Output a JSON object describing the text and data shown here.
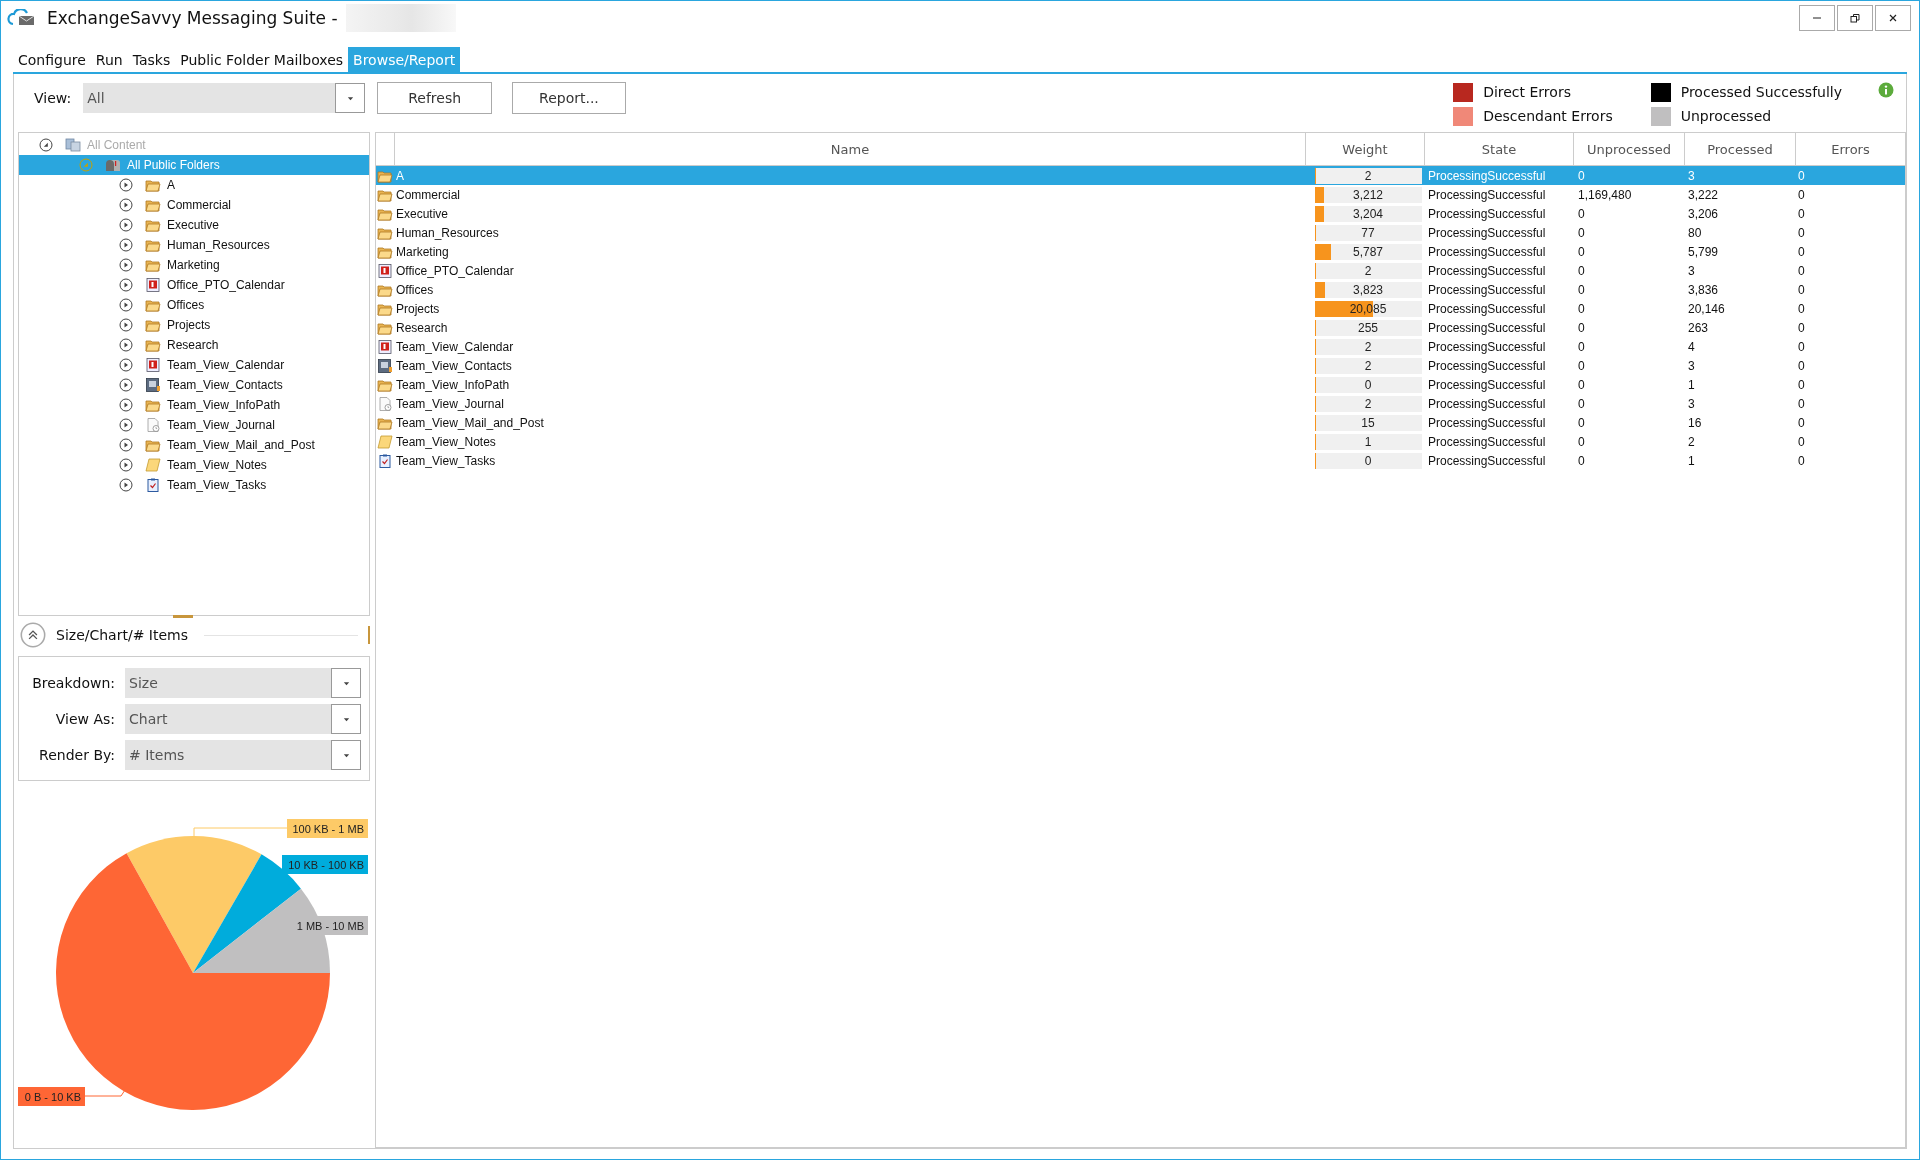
{
  "window": {
    "title": "ExchangeSavvy Messaging Suite -"
  },
  "tabs": [
    {
      "label": "Configure",
      "selected": false
    },
    {
      "label": "Run",
      "selected": false
    },
    {
      "label": "Tasks",
      "selected": false
    },
    {
      "label": "Public Folder Mailboxes",
      "selected": false
    },
    {
      "label": "Browse/Report",
      "selected": true
    }
  ],
  "toolbar": {
    "view_label": "View:",
    "view_value": "All",
    "buttons": [
      "Refresh",
      "Report..."
    ]
  },
  "legend": [
    {
      "label": "Direct Errors",
      "color": "#b8281f"
    },
    {
      "label": "Descendant Errors",
      "color": "#f08878"
    },
    {
      "label": "Processed Successfully",
      "color": "#000000"
    },
    {
      "label": "Unprocessed",
      "color": "#c0bfc0"
    }
  ],
  "tree": [
    {
      "label": "All Content",
      "kind": "content",
      "expanded": true,
      "disabled": true,
      "selected": false,
      "children": [
        {
          "label": "All Public Folders",
          "kind": "mailbox",
          "expanded": true,
          "disabled": false,
          "selected": true,
          "children": [
            {
              "label": "A",
              "kind": "folder",
              "expanded": false,
              "disabled": false,
              "selected": false
            },
            {
              "label": "Commercial",
              "kind": "folder",
              "expanded": false,
              "disabled": false,
              "selected": false
            },
            {
              "label": "Executive",
              "kind": "folder",
              "expanded": false,
              "disabled": false,
              "selected": false
            },
            {
              "label": "Human_Resources",
              "kind": "folder",
              "expanded": false,
              "disabled": false,
              "selected": false
            },
            {
              "label": "Marketing",
              "kind": "folder",
              "expanded": false,
              "disabled": false,
              "selected": false
            },
            {
              "label": "Office_PTO_Calendar",
              "kind": "calendar",
              "expanded": false,
              "disabled": false,
              "selected": false
            },
            {
              "label": "Offices",
              "kind": "folder",
              "expanded": false,
              "disabled": false,
              "selected": false
            },
            {
              "label": "Projects",
              "kind": "folder",
              "expanded": false,
              "disabled": false,
              "selected": false
            },
            {
              "label": "Research",
              "kind": "folder",
              "expanded": false,
              "disabled": false,
              "selected": false
            },
            {
              "label": "Team_View_Calendar",
              "kind": "calendar",
              "expanded": false,
              "disabled": false,
              "selected": false
            },
            {
              "label": "Team_View_Contacts",
              "kind": "contacts",
              "expanded": false,
              "disabled": false,
              "selected": false
            },
            {
              "label": "Team_View_InfoPath",
              "kind": "folder",
              "expanded": false,
              "disabled": false,
              "selected": false
            },
            {
              "label": "Team_View_Journal",
              "kind": "journal",
              "expanded": false,
              "disabled": false,
              "selected": false
            },
            {
              "label": "Team_View_Mail_and_Post",
              "kind": "folder",
              "expanded": false,
              "disabled": false,
              "selected": false
            },
            {
              "label": "Team_View_Notes",
              "kind": "notes",
              "expanded": false,
              "disabled": false,
              "selected": false
            },
            {
              "label": "Team_View_Tasks",
              "kind": "tasks",
              "expanded": false,
              "disabled": false,
              "selected": false
            }
          ]
        }
      ]
    }
  ],
  "breakdown": {
    "title": "Size/Chart/# Items",
    "expanded": true,
    "fields": [
      {
        "label": "Breakdown:",
        "value": "Size"
      },
      {
        "label": "View As:",
        "value": "Chart"
      },
      {
        "label": "Render By:",
        "value": "# Items"
      }
    ]
  },
  "size_chart": {
    "slices": [
      {
        "label": "100 KB - 1 MB",
        "color": "#fdca67"
      },
      {
        "label": "10 KB - 100 KB",
        "color": "#00acdc"
      },
      {
        "label": "1 MB - 10 MB",
        "color": "#c0bfc0"
      },
      {
        "label": "0 B - 10 KB",
        "color": "#fe6635"
      }
    ]
  },
  "table": {
    "columns": [
      "Name",
      "Weight",
      "State",
      "Unprocessed",
      "Processed",
      "Errors"
    ],
    "rows": [
      {
        "name": "A",
        "kind": "folder",
        "weight": "2",
        "level": 0,
        "state": "ProcessingSuccessful",
        "unprocessed": "0",
        "processed": "3",
        "errors": "0",
        "selected": true
      },
      {
        "name": "Commercial",
        "kind": "folder",
        "weight": "3,212",
        "level": 0.086,
        "state": "ProcessingSuccessful",
        "unprocessed": "1,169,480",
        "processed": "3,222",
        "errors": "0",
        "selected": false
      },
      {
        "name": "Executive",
        "kind": "folder",
        "weight": "3,204",
        "level": 0.086,
        "state": "ProcessingSuccessful",
        "unprocessed": "0",
        "processed": "3,206",
        "errors": "0",
        "selected": false
      },
      {
        "name": "Human_Resources",
        "kind": "folder",
        "weight": "77",
        "level": 0,
        "state": "ProcessingSuccessful",
        "unprocessed": "0",
        "processed": "80",
        "errors": "0",
        "selected": false
      },
      {
        "name": "Marketing",
        "kind": "folder",
        "weight": "5,787",
        "level": 0.15,
        "state": "ProcessingSuccessful",
        "unprocessed": "0",
        "processed": "5,799",
        "errors": "0",
        "selected": false
      },
      {
        "name": "Office_PTO_Calendar",
        "kind": "calendar",
        "weight": "2",
        "level": 0,
        "state": "ProcessingSuccessful",
        "unprocessed": "0",
        "processed": "3",
        "errors": "0",
        "selected": false
      },
      {
        "name": "Offices",
        "kind": "folder",
        "weight": "3,823",
        "level": 0.1,
        "state": "ProcessingSuccessful",
        "unprocessed": "0",
        "processed": "3,836",
        "errors": "0",
        "selected": false
      },
      {
        "name": "Projects",
        "kind": "folder",
        "weight": "20,085",
        "level": 0.55,
        "state": "ProcessingSuccessful",
        "unprocessed": "0",
        "processed": "20,146",
        "errors": "0",
        "selected": false
      },
      {
        "name": "Research",
        "kind": "folder",
        "weight": "255",
        "level": 0,
        "state": "ProcessingSuccessful",
        "unprocessed": "0",
        "processed": "263",
        "errors": "0",
        "selected": false
      },
      {
        "name": "Team_View_Calendar",
        "kind": "calendar",
        "weight": "2",
        "level": 0,
        "state": "ProcessingSuccessful",
        "unprocessed": "0",
        "processed": "4",
        "errors": "0",
        "selected": false
      },
      {
        "name": "Team_View_Contacts",
        "kind": "contacts",
        "weight": "2",
        "level": 0,
        "state": "ProcessingSuccessful",
        "unprocessed": "0",
        "processed": "3",
        "errors": "0",
        "selected": false
      },
      {
        "name": "Team_View_InfoPath",
        "kind": "folder",
        "weight": "0",
        "level": 0,
        "state": "ProcessingSuccessful",
        "unprocessed": "0",
        "processed": "1",
        "errors": "0",
        "selected": false
      },
      {
        "name": "Team_View_Journal",
        "kind": "journal",
        "weight": "2",
        "level": 0,
        "state": "ProcessingSuccessful",
        "unprocessed": "0",
        "processed": "3",
        "errors": "0",
        "selected": false
      },
      {
        "name": "Team_View_Mail_and_Post",
        "kind": "folder",
        "weight": "15",
        "level": 0,
        "state": "ProcessingSuccessful",
        "unprocessed": "0",
        "processed": "16",
        "errors": "0",
        "selected": false
      },
      {
        "name": "Team_View_Notes",
        "kind": "notes",
        "weight": "1",
        "level": 0,
        "state": "ProcessingSuccessful",
        "unprocessed": "0",
        "processed": "2",
        "errors": "0",
        "selected": false
      },
      {
        "name": "Team_View_Tasks",
        "kind": "tasks",
        "weight": "0",
        "level": 0,
        "state": "ProcessingSuccessful",
        "unprocessed": "0",
        "processed": "1",
        "errors": "0",
        "selected": false
      }
    ]
  }
}
